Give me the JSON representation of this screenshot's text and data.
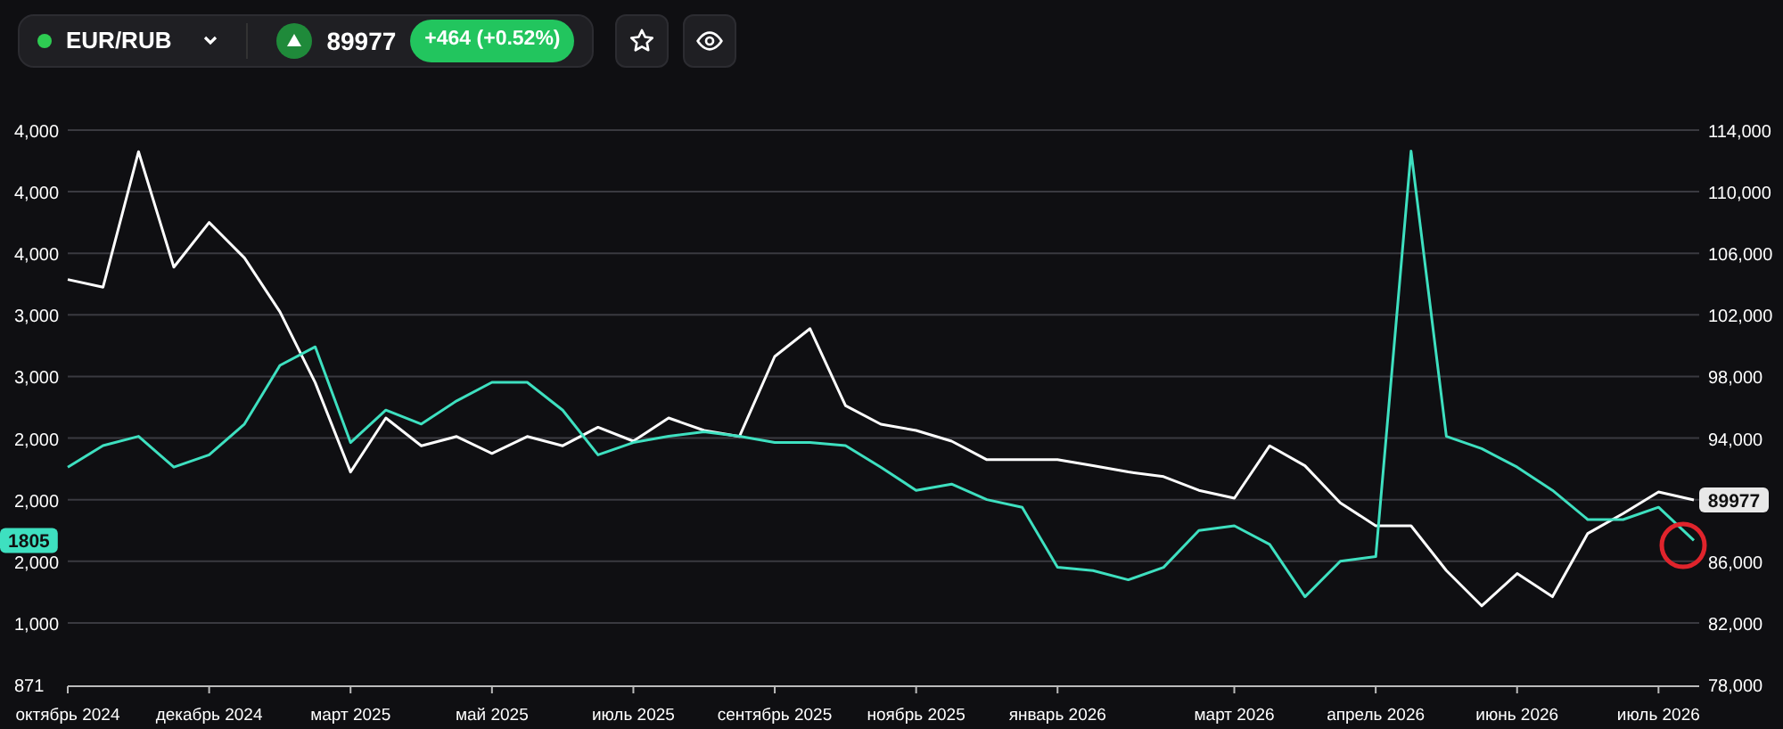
{
  "ticker": {
    "symbol": "EUR/RUB",
    "color": "#2ecc52",
    "price": "89977",
    "change": "+464 (+0.52%)"
  },
  "actions": [
    {
      "kind": "star"
    },
    {
      "kind": "eye"
    }
  ],
  "chart": {
    "left_axis": [
      "4,000",
      "4,000",
      "4,000",
      "3,000",
      "3,000",
      "2,000",
      "2,000",
      "2,000",
      "1,000"
    ],
    "chart_data": {
      "type": "line",
      "categories": [
        "октябрь 2024",
        null,
        null,
        null,
        "декабрь 2024",
        null,
        null,
        null,
        "март 2025",
        null,
        null,
        null,
        "май 2025",
        null,
        null,
        null,
        "июль 2025",
        null,
        null,
        null,
        "сентябрь 2025",
        null,
        null,
        null,
        "ноябрь 2025",
        null,
        null,
        null,
        "январь 2026",
        null,
        null,
        null,
        null,
        "март 2026",
        null,
        null,
        null,
        "апрель 2026",
        null,
        null,
        null,
        "июнь 2026",
        null,
        null,
        null,
        "июль 2026",
        null
      ],
      "ylim": [
        78000,
        114000
      ],
      "yticks": [
        {
          "value": 114000,
          "label": "114,000"
        },
        {
          "value": 110000,
          "label": "110,000"
        },
        {
          "value": 106000,
          "label": "106,000"
        },
        {
          "value": 102000,
          "label": "102,000"
        },
        {
          "value": 98000,
          "label": "98,000"
        },
        {
          "value": 94000,
          "label": "94,000"
        },
        {
          "value": 89977,
          "label": "89977"
        },
        {
          "value": 86000,
          "label": "86,000"
        },
        {
          "value": 82000,
          "label": "82,000"
        },
        {
          "value": 78000,
          "label": "78,000"
        }
      ],
      "grid": true,
      "y2lim": [
        871,
        4466
      ],
      "y2ticks": [
        {
          "value": 1805,
          "label": "1805"
        },
        {
          "value": 871,
          "label": "871"
        }
      ],
      "series": [
        {
          "color": "#ffffff",
          "values": [
            104300,
            103800,
            112600,
            105100,
            108000,
            105700,
            102200,
            97600,
            91800,
            95300,
            93500,
            94100,
            93000,
            94100,
            93500,
            94700,
            93800,
            95300,
            94500,
            94100,
            99300,
            101100,
            96100,
            94900,
            94500,
            93800,
            92600,
            92600,
            92600,
            92200,
            91800,
            91500,
            90600,
            90100,
            93500,
            92200,
            89800,
            88300,
            88300,
            85400,
            83100,
            85200,
            83700,
            87800,
            89100,
            90500,
            89977
          ]
        },
        {
          "color": "#3ee0c0",
          "axis": "y2",
          "values": [
            2280,
            2420,
            2480,
            2280,
            2360,
            2560,
            2940,
            3060,
            2440,
            2650,
            2560,
            2710,
            2830,
            2830,
            2650,
            2360,
            2440,
            2480,
            2510,
            2480,
            2440,
            2440,
            2420,
            2280,
            2130,
            2170,
            2070,
            2020,
            1630,
            1610,
            1550,
            1630,
            1870,
            1900,
            1780,
            1440,
            1670,
            1700,
            4330,
            2480,
            2400,
            2280,
            2130,
            1940,
            1940,
            2020,
            1805
          ]
        }
      ]
    }
  }
}
